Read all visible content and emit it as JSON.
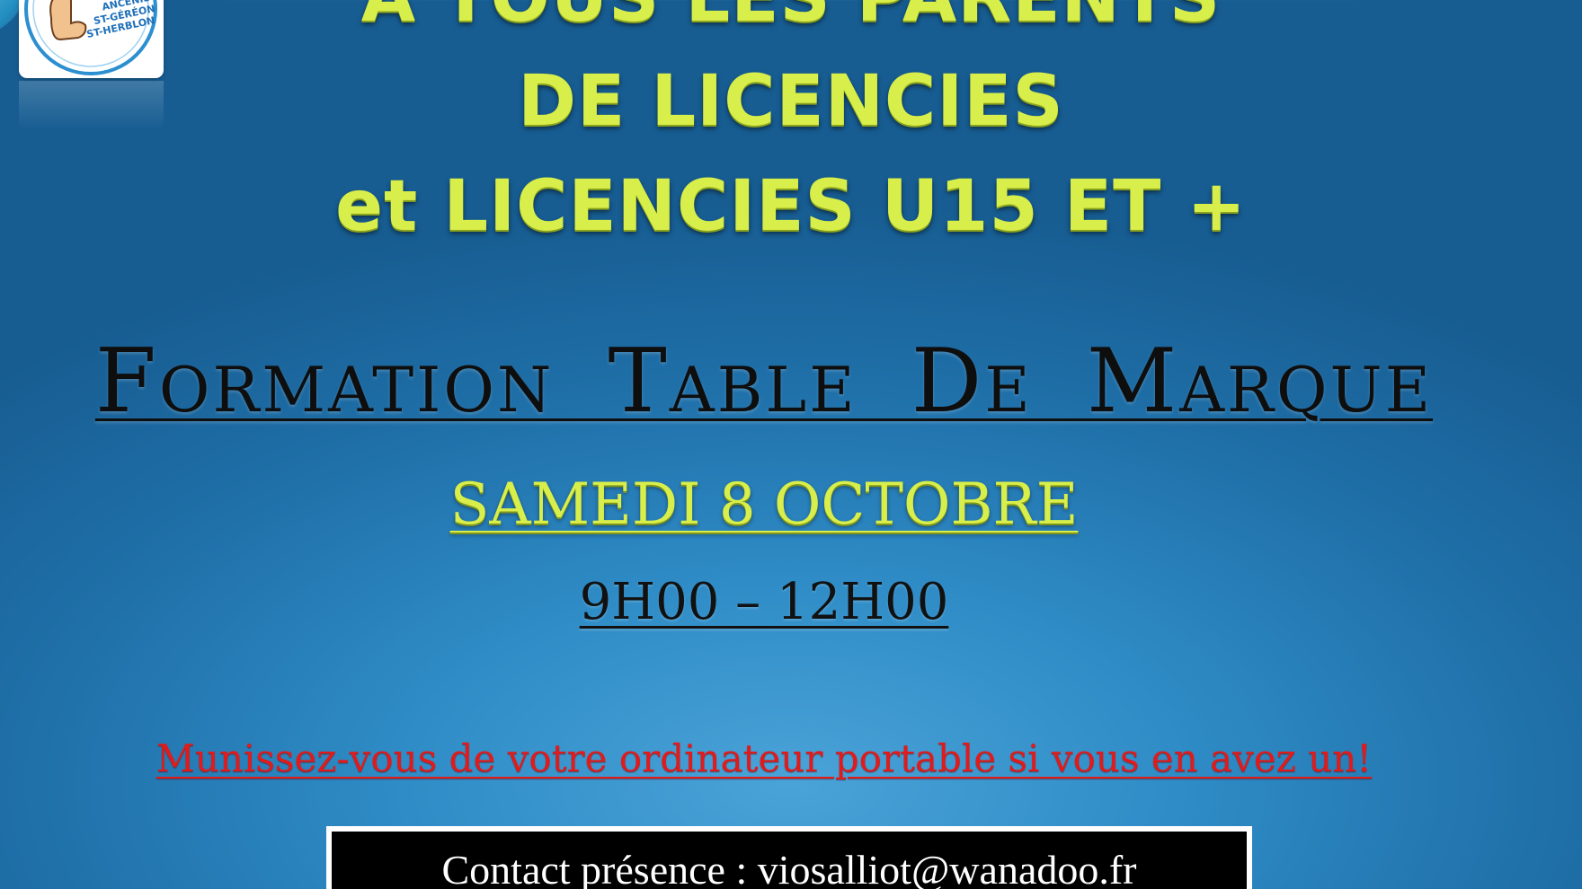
{
  "colors": {
    "background": "#2f8cc6",
    "headline": "#d8ee4a",
    "title": "#0e0e0e",
    "notice": "#e21a1a",
    "contact_box": "#000000"
  },
  "logo": {
    "lines": [
      "ANCENIS",
      "ST-GÉRÉON",
      "ST-HERBLON"
    ]
  },
  "headline": {
    "line1": "A TOUS LES PARENTS",
    "line2": "DE LICENCIES",
    "line3": "et LICENCIES U15 ET +"
  },
  "event": {
    "title": "Formation Table De Marque",
    "date": "SAMEDI 8 OCTOBRE",
    "hours": "9H00 – 12H00"
  },
  "notice": "Munissez-vous de votre ordinateur portable si vous en avez un!",
  "contact": "Contact présence : viosalliot@wanadoo.fr"
}
